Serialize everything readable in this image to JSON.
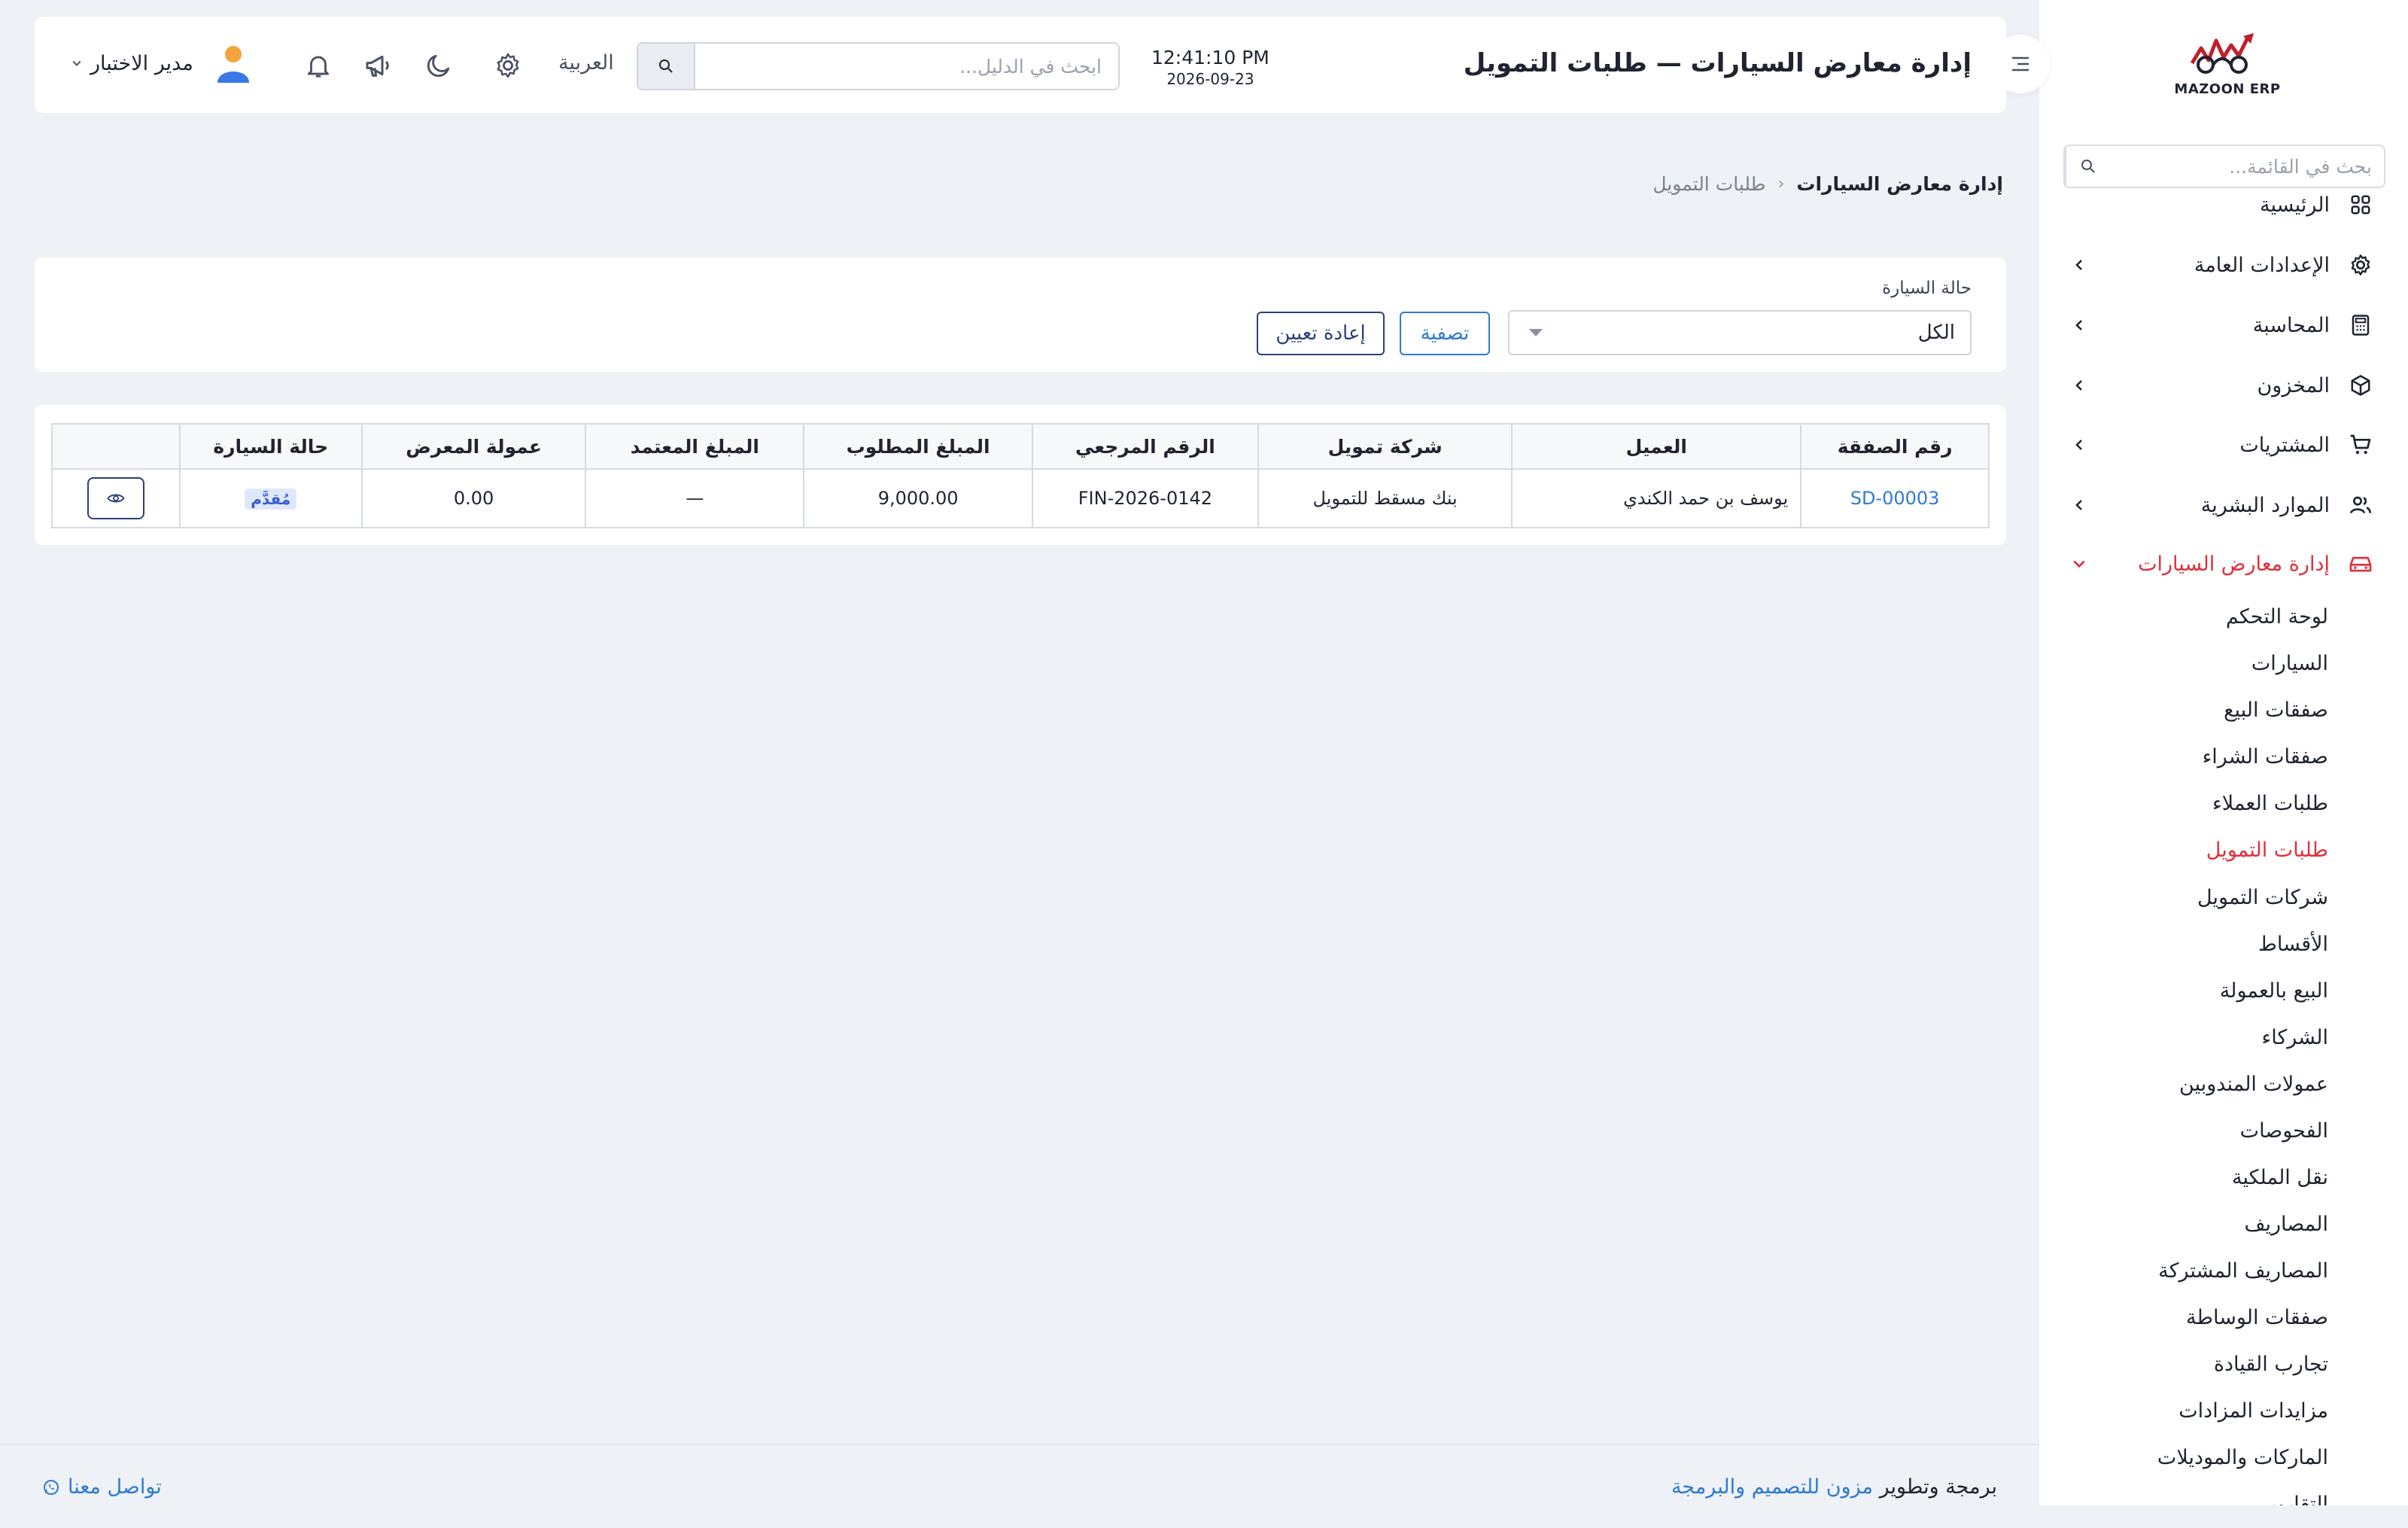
{
  "app": {
    "logo_text": "MAZOON ERP"
  },
  "sidebar": {
    "search_placeholder": "بحث في القائمة...",
    "items": [
      {
        "label": "الرئيسية",
        "icon": "grid-icon"
      },
      {
        "label": "الإعدادات العامة",
        "icon": "gear-icon"
      },
      {
        "label": "المحاسبة",
        "icon": "calculator-icon"
      },
      {
        "label": "المخزون",
        "icon": "box-icon"
      },
      {
        "label": "المشتريات",
        "icon": "cart-icon"
      },
      {
        "label": "الموارد البشرية",
        "icon": "users-icon"
      },
      {
        "label": "إدارة معارض السيارات",
        "icon": "car-icon"
      }
    ],
    "subitems": [
      "لوحة التحكم",
      "السيارات",
      "صفقات البيع",
      "صفقات الشراء",
      "طلبات العملاء",
      "طلبات التمويل",
      "شركات التمويل",
      "الأقساط",
      "البيع بالعمولة",
      "الشركاء",
      "عمولات المندوبين",
      "الفحوصات",
      "نقل الملكية",
      "المصاريف",
      "المصاريف المشتركة",
      "صفقات الوساطة",
      "تجارب القيادة",
      "مزايدات المزادات",
      "الماركات والموديلات",
      "التقارير"
    ],
    "active_subitem": "طلبات التمويل"
  },
  "header": {
    "title": "إدارة معارض السيارات — طلبات التمويل",
    "time": "12:41:10 PM",
    "date": "2026-09-23",
    "search_placeholder": "ابحث في الدليل...",
    "language": "العربية",
    "user_name": "مدير الاختبار"
  },
  "breadcrumb": {
    "parent": "إدارة معارض السيارات",
    "current": "طلبات التمويل"
  },
  "filter": {
    "label": "حالة السيارة",
    "selected": "الكل",
    "filter_button": "تصفية",
    "reset_button": "إعادة تعيين"
  },
  "table": {
    "headers": [
      "رقم الصفقة",
      "العميل",
      "شركة تمويل",
      "الرقم المرجعي",
      "المبلغ المطلوب",
      "المبلغ المعتمد",
      "عمولة المعرض",
      "حالة السيارة"
    ],
    "rows": [
      {
        "deal": "SD-00003",
        "client": "يوسف بن حمد الكندي",
        "company": "بنك مسقط للتمويل",
        "ref": "FIN-2026-0142",
        "requested": "9,000.00",
        "approved": "—",
        "commission": "0.00",
        "status": "مُقدَّم"
      }
    ]
  },
  "footer": {
    "credit_prefix": "برمجة وتطوير",
    "credit_company": "مزون للتصميم والبرمجة",
    "contact": "تواصل معنا"
  },
  "colors": {
    "accent": "#e0303c",
    "link": "#2f7bd1",
    "navy": "#2b3f7a",
    "background": "#eef1f6"
  }
}
